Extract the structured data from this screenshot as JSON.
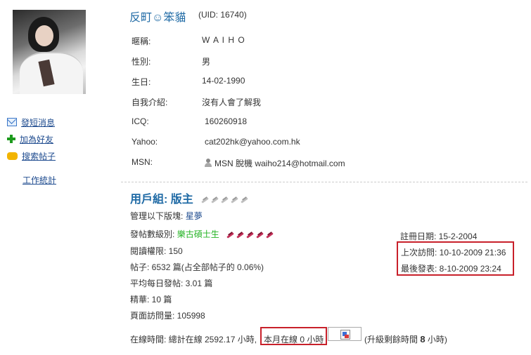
{
  "profile": {
    "username": "反町☺笨貓",
    "uid_text": "(UID: 16740)"
  },
  "sidebar": {
    "items": [
      {
        "label": "發短消息",
        "icon": "mail-icon"
      },
      {
        "label": "加為好友",
        "icon": "plus-icon"
      },
      {
        "label": "搜索帖子",
        "icon": "speech-bubble-icon"
      },
      {
        "label": "工作統計"
      }
    ]
  },
  "info": {
    "rows": [
      {
        "key": "暱稱:",
        "value": "W A I  H O"
      },
      {
        "key": "性別:",
        "value": "男"
      },
      {
        "key": "生日:",
        "value": "14-02-1990"
      },
      {
        "key": "自我介紹:",
        "value": "沒有人會了解我"
      },
      {
        "key": "ICQ:",
        "value": "160260918"
      },
      {
        "key": "Yahoo:",
        "value": "cat202hk@yahoo.com.hk"
      },
      {
        "key": "MSN:",
        "value": "MSN 脫機 waiho214@hotmail.com"
      }
    ]
  },
  "group": {
    "label": "用戶組:",
    "value": "版主"
  },
  "stats": {
    "moderates_label": "管理以下版塊:",
    "moderates_value": "星夢",
    "rank_label": "發帖數級別:",
    "rank_value": "樂古碩士生",
    "read_perm": "閱讀權限: 150",
    "posts": "帖子: 6532 篇(占全部帖子的 0.06%)",
    "daily": "平均每日發帖: 3.01 篇",
    "digest": "精華: 10 篇",
    "pageviews": "頁面訪問量: 105998"
  },
  "dates": {
    "registered": "註冊日期: 15-2-2004",
    "last_visit": "上次訪問: 10-10-2009 21:36",
    "last_post": "最後發表: 8-10-2009 23:24"
  },
  "online": {
    "total": "在線時間: 總計在線 2592.17 小時,",
    "month": "本月在線 0 小時",
    "upgrade_prefix": "(升級剩餘時間",
    "upgrade_hours": "8",
    "upgrade_suffix": "小時)",
    "progress": 0
  },
  "colors": {
    "link": "#1e4b8f",
    "title": "#1f6aa5",
    "highlight_border": "#c8202a",
    "rank_green": "#23b323"
  }
}
